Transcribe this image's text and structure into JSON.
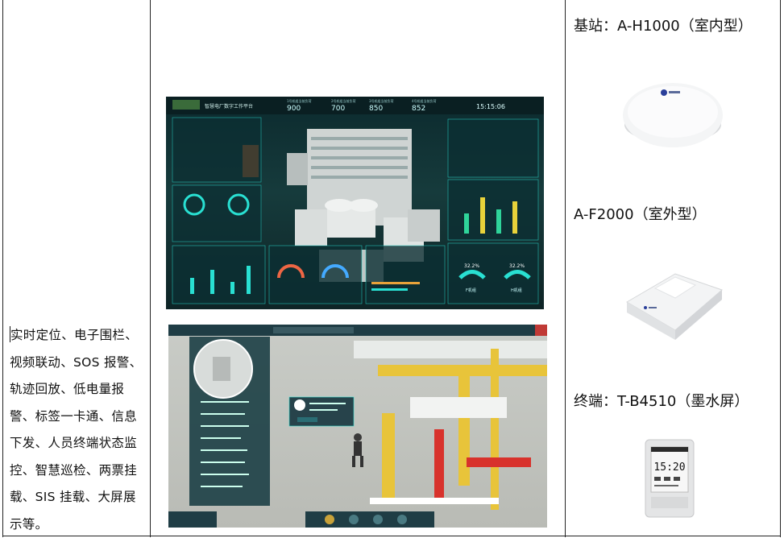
{
  "features_text": "实时定位、电子围栏、视频联动、SOS 报警、轨迹回放、低电量报警、标签一卡通、信息下发、人员终端状态监控、智慧巡检、两票挂载、SIS 挂载、大屏展示等。",
  "devices": {
    "base_station_label": "基站：A-H1000（室内型）",
    "outdoor_label": "A-F2000（室外型）",
    "terminal_label": "终端：T-B4510（墨水屏）"
  },
  "dashboard": {
    "title": "智慧电厂数字工作平台",
    "stats": [
      {
        "label": "1号机组当前负荷",
        "value": "900"
      },
      {
        "label": "2号机组当前负荷",
        "value": "700"
      },
      {
        "label": "3号机组当前负荷",
        "value": "850"
      },
      {
        "label": "4号机组当前负荷",
        "value": "852"
      }
    ],
    "clock": "15:15:06",
    "gauge_values": [
      "32.2%",
      "32.2%"
    ],
    "gauge_labels": [
      "F机组",
      "H机组"
    ]
  },
  "terminal_screen": {
    "time": "15:20"
  },
  "colors": {
    "dash_accent": "#29e0d2",
    "dash_bg": "#0e2a2d",
    "scene_pipe": "#e8c43a",
    "scene_red": "#d8322c"
  }
}
